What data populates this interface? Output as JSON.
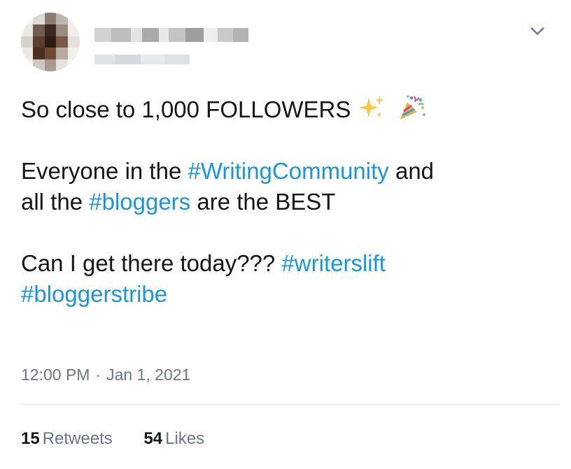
{
  "tweet": {
    "line1": "So close to 1,000 FOLLOWERS",
    "line2_pre": "Everyone in the ",
    "line2_tag1": "#WritingCommunity",
    "line2_post": " and",
    "line3_pre": "all the ",
    "line3_tag": "#bloggers",
    "line3_post": " are the BEST",
    "line4_pre": "Can I get there today??? ",
    "line4_tag": "#writerslift",
    "line5_tag": "#bloggerstribe"
  },
  "meta": {
    "time": "12:00 PM",
    "separator": "·",
    "date": "Jan 1, 2021"
  },
  "stats": {
    "retweets_count": "15",
    "retweets_label": "Retweets",
    "likes_count": "54",
    "likes_label": "Likes"
  },
  "icons": {
    "sparkles": "sparkles-icon",
    "party_popper": "party-popper-icon",
    "chevron": "chevron-down-icon"
  },
  "colors": {
    "hashtag": "#1b95e0",
    "secondary_text": "#657786",
    "primary_text": "#14171a",
    "divider": "#e1e8ed"
  }
}
